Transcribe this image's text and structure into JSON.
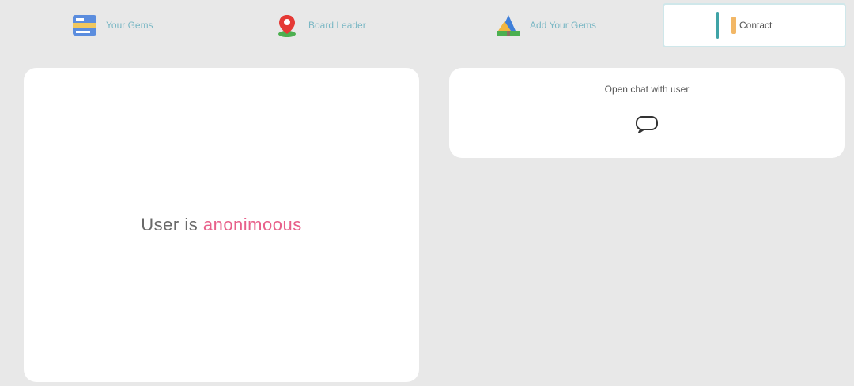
{
  "tabs": [
    {
      "label": "Your Gems",
      "icon": "id-card-icon"
    },
    {
      "label": "Board Leader",
      "icon": "map-pin-icon"
    },
    {
      "label": "Add Your Gems",
      "icon": "tree-icon"
    },
    {
      "label": "Contact",
      "icon": "tag-icon",
      "active": true
    }
  ],
  "user": {
    "prefix": "User is",
    "name": "anonimoous"
  },
  "chat": {
    "title": "Open chat with user",
    "icon": "chat-bubble-icon"
  },
  "colors": {
    "background": "#e8e8e8",
    "card": "#ffffff",
    "tab_text": "#7ab7c4",
    "accent": "#3fa3a6",
    "username": "#e8608a"
  }
}
